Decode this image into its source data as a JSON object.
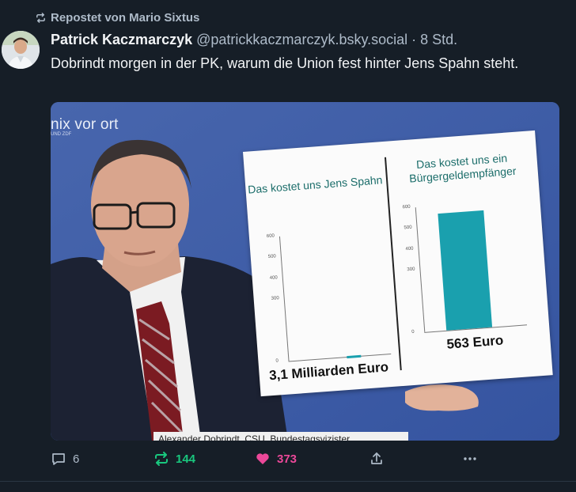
{
  "repost": {
    "label": "Repostet von Mario Sixtus",
    "icon": "repost-icon"
  },
  "author": {
    "name": "Patrick Kaczmarczyk",
    "handle": "@patrickkaczmarczyk.bsky.social",
    "time": "· 8 Std."
  },
  "post": {
    "text": "Dobrindt morgen in der PK, warum die Union fest hinter Jens Spahn steht."
  },
  "image": {
    "logo": "nix vor ort",
    "logo_sub": "UND ZDF",
    "caption": "Alexander Dobrindt, CSU, Bundestagsvizister",
    "board": {
      "left_title": "Das kostet uns Jens Spahn",
      "right_title": "Das kostet uns ein Bürgergeldempfänger",
      "left_amount": "3,1 Milliarden Euro",
      "right_amount": "563 Euro",
      "left_ticks": [
        "600",
        "500",
        "400",
        "300",
        "0"
      ],
      "right_ticks": [
        "600",
        "500",
        "400",
        "300",
        "0"
      ],
      "left_bar_value": 3.1,
      "right_bar_value": 563,
      "bar_color": "#1aa0ae"
    }
  },
  "actions": {
    "reply_count": "6",
    "repost_count": "144",
    "like_count": "373",
    "repost_color": "#19c77e",
    "like_color": "#ec4899"
  }
}
